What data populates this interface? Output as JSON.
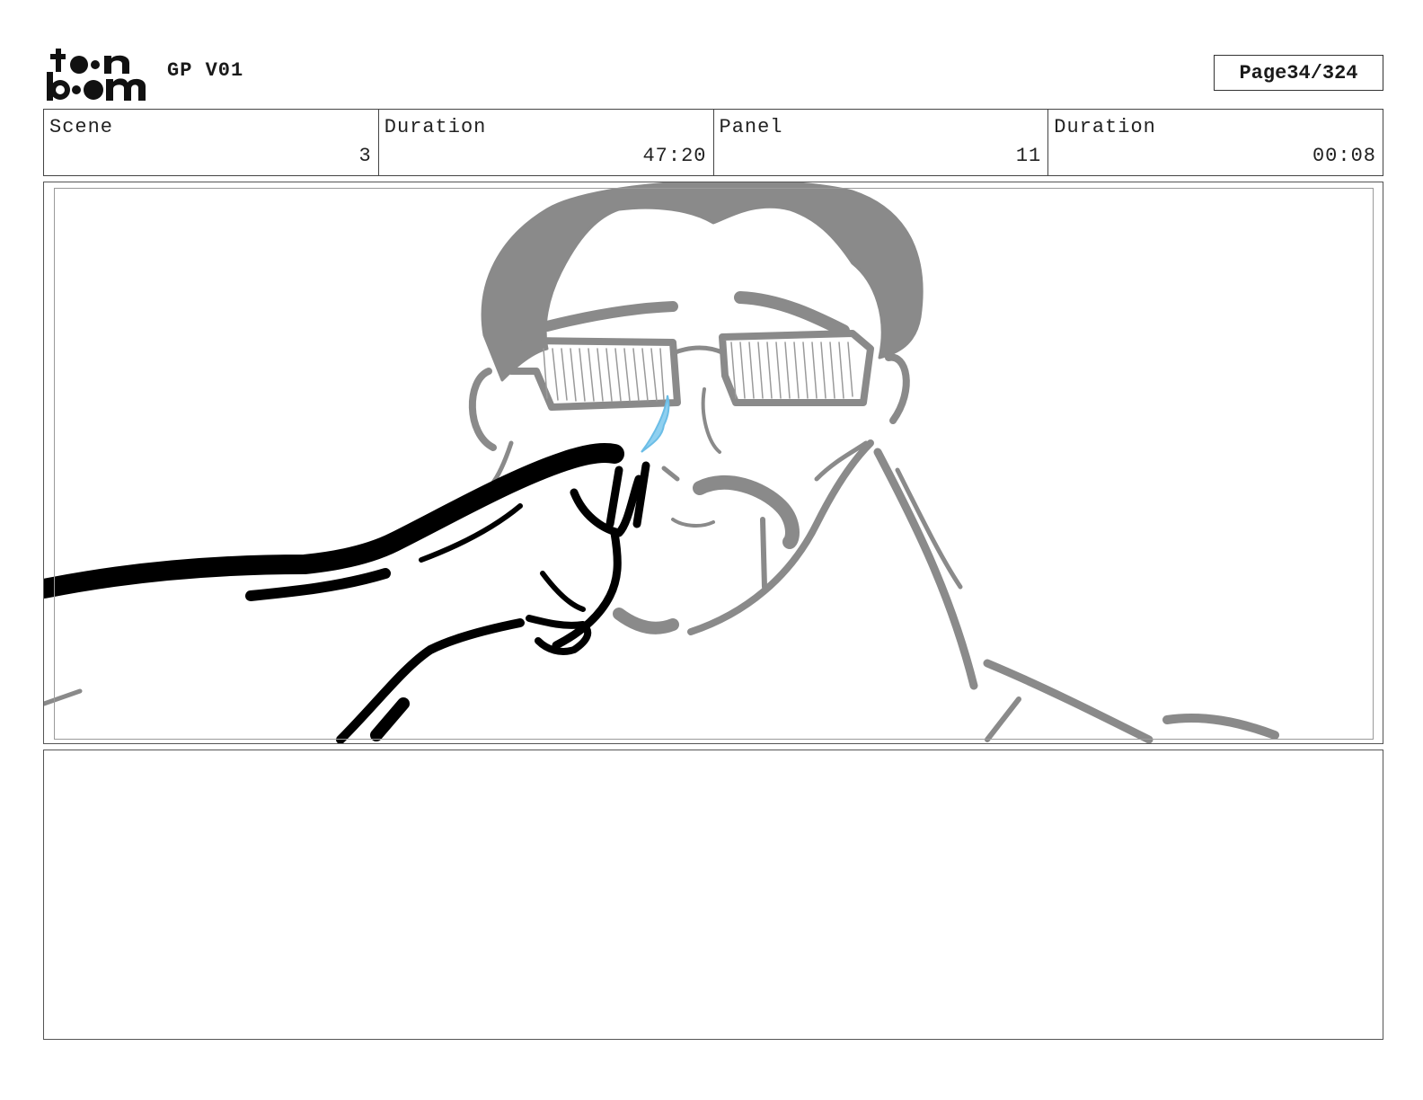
{
  "header": {
    "logo_text": "toon boom",
    "project_title": "GP V01",
    "page_label": "Page",
    "page_number": "34/324"
  },
  "info_bar": {
    "scene_label": "Scene",
    "scene_value": "3",
    "scene_duration_label": "Duration",
    "scene_duration_value": "47:20",
    "panel_label": "Panel",
    "panel_value": "11",
    "panel_duration_label": "Duration",
    "panel_duration_value": "00:08"
  },
  "panel_image": {
    "icon": "storyboard-sketch",
    "colors": {
      "character": "#8a8a8a",
      "hand": "#000000",
      "tear": "#8fd0f0"
    }
  },
  "notes": {
    "text": ""
  }
}
